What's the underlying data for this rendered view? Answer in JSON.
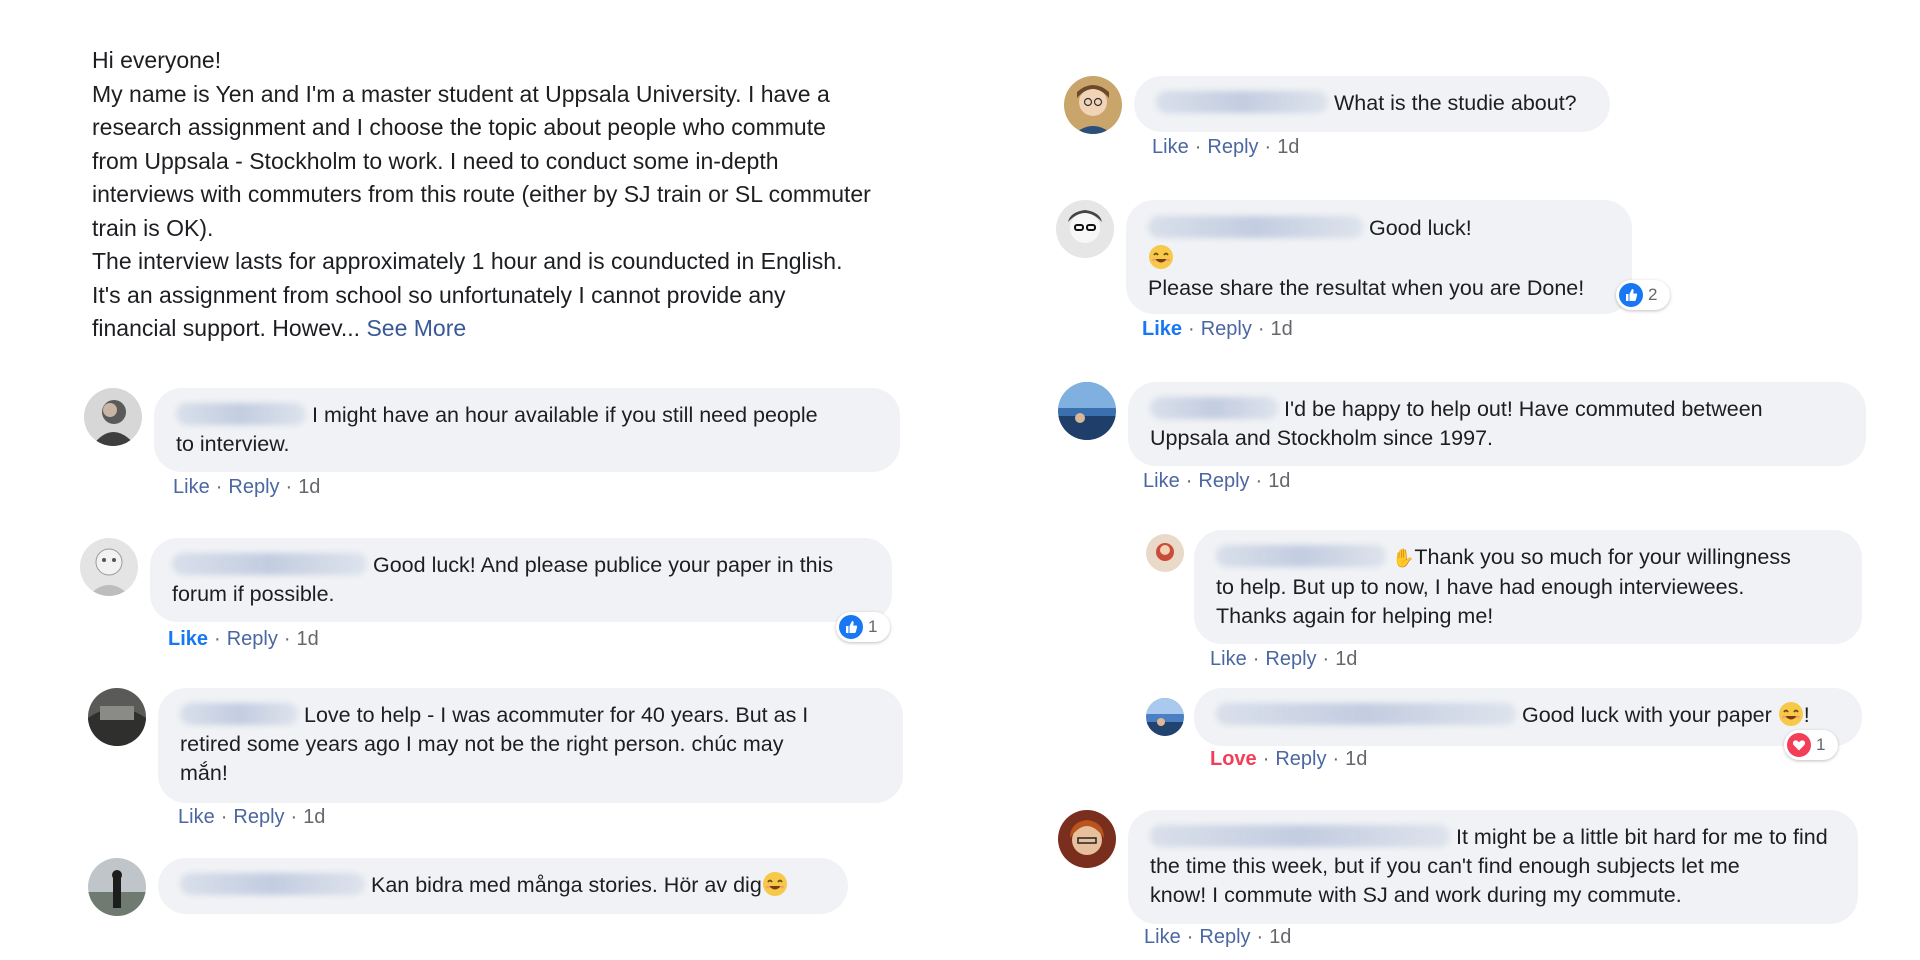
{
  "post": {
    "greeting": "Hi everyone!",
    "line1": "My name is Yen and I'm a master student at Uppsala University. I have a",
    "line2": "research assignment and I choose the topic about people who commute",
    "line3": "from Uppsala - Stockholm to work. I need to conduct some in-depth",
    "line4": "interviews with commuters from this route (either by SJ train or SL commuter",
    "line5": "train is OK).",
    "line6": "The interview lasts for approximately 1 hour and is counducted in English.",
    "line7": "It's an assignment from school so unfortunately I cannot provide any",
    "line8_prefix": "financial support. Howev... ",
    "see_more": "See More"
  },
  "labels": {
    "like": "Like",
    "reply": "Reply",
    "love": "Love",
    "dot": "·"
  },
  "colors": {
    "link": "#385898",
    "like_active": "#1877f2",
    "love_active": "#f33e58",
    "bubble": "#f0f2f5"
  },
  "comments": {
    "c1": {
      "text1": "I might have an hour available if you still need people",
      "text2": "to interview.",
      "time": "1d"
    },
    "c2": {
      "text1": "Good luck! And please publice your paper in this",
      "text2": "forum if possible.",
      "time": "1d",
      "reaction_count": "1",
      "reaction_icon": "thumbs-up-icon"
    },
    "c3": {
      "text1": "Love to help - I was acommuter for 40 years. But as I",
      "text2": "retired some years ago I may not be the right person. chúc may",
      "text3": "mắn!",
      "time": "1d"
    },
    "c4": {
      "text1": "Kan bidra med många stories. Hör av dig",
      "emoji": "smiling-face-emoji"
    },
    "r1": {
      "text1": "What is the studie about?",
      "time": "1d"
    },
    "r2": {
      "text1": "Good luck!",
      "text2": "Please share the resultat when you are Done!",
      "emoji": "smiling-face-emoji",
      "time": "1d",
      "reaction_count": "2",
      "reaction_icon": "thumbs-up-icon"
    },
    "r3": {
      "text1": "I'd be happy to help out! Have commuted between",
      "text2": "Uppsala and Stockholm since 1997.",
      "time": "1d"
    },
    "r3a": {
      "text1": "Thank you so much for your willingness",
      "text2": "to help. But up to now, I have had enough interviewees.",
      "text3": "Thanks again for helping me!",
      "emoji": "waving-hand-emoji",
      "time": "1d"
    },
    "r3b": {
      "text1": "Good luck with your paper",
      "suffix": "!",
      "emoji": "smiling-face-emoji",
      "time": "1d",
      "reaction_count": "1",
      "reaction_icon": "heart-icon"
    },
    "r4": {
      "text1": "It might be a little bit hard for me to find",
      "text2": "the time this week, but if you can't find enough subjects let me",
      "text3": "know! I commute with SJ and work during my commute.",
      "time": "1d"
    }
  }
}
